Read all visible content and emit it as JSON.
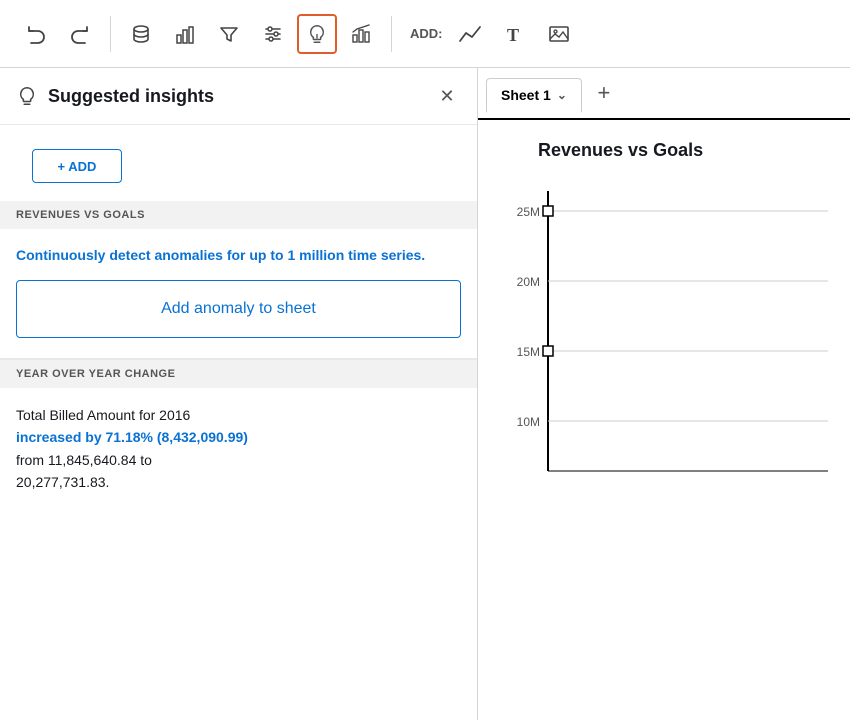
{
  "toolbar": {
    "undo_label": "↩",
    "redo_label": "↪",
    "add_label": "ADD:",
    "active_tool": "insights"
  },
  "left_panel": {
    "title": "Suggested insights",
    "close_label": "✕",
    "add_button_label": "+ ADD",
    "section1_label": "REVENUES VS GOALS",
    "insight_blue_text": "Continuously detect anomalies for up to 1 million time series.",
    "add_anomaly_button": "Add anomaly to sheet",
    "section2_label": "YEAR OVER YEAR CHANGE",
    "yoy_line1": "Total Billed Amount for 2016",
    "yoy_highlight": "increased by 71.18% (8,432,090.99)",
    "yoy_line2": "from 11,845,640.84 to",
    "yoy_line3": "20,277,731.83."
  },
  "right_panel": {
    "sheet_tab_label": "Sheet 1",
    "add_sheet_label": "+",
    "chart_title": "Revenues vs Goals",
    "chart_y_labels": [
      "25M",
      "20M",
      "15M",
      "10M"
    ],
    "chart_y_values": [
      25,
      20,
      15,
      10
    ]
  }
}
